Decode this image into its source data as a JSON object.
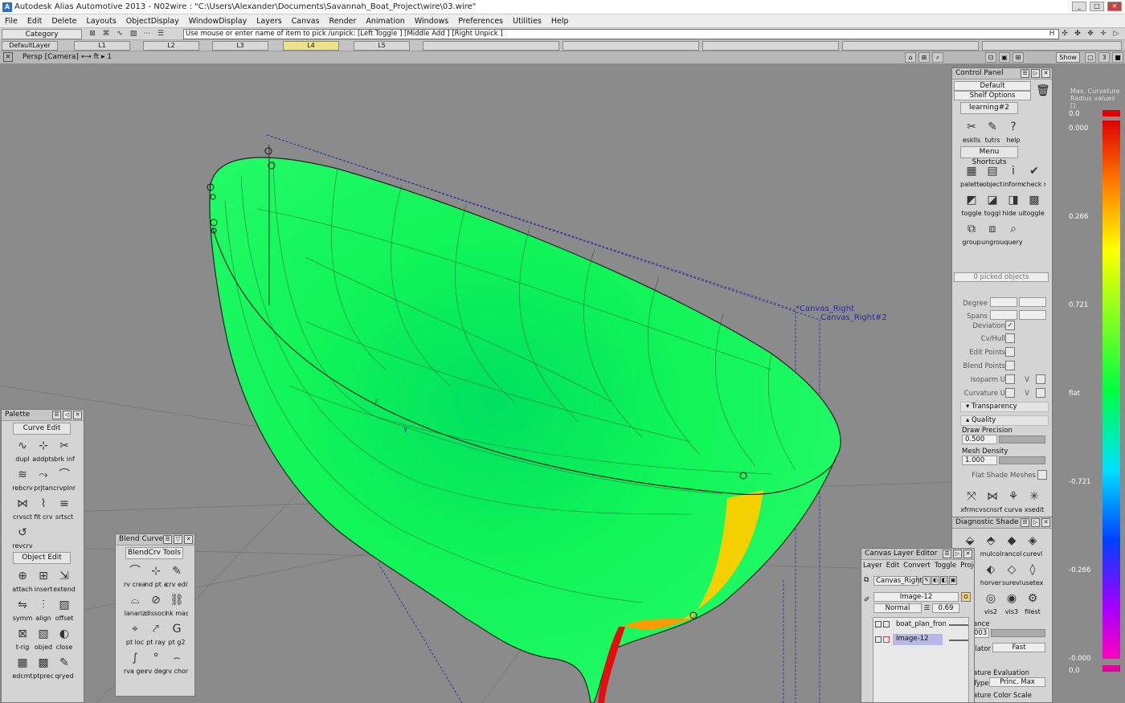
{
  "window": {
    "title": "Autodesk Alias Automotive 2013 - N02wire : \"C:\\Users\\Alexander\\Documents\\Savannah_Boat_Project\\wire\\03.wire\"",
    "app_icon_letter": "A"
  },
  "menu": [
    "File",
    "Edit",
    "Delete",
    "Layouts",
    "ObjectDisplay",
    "WindowDisplay",
    "Layers",
    "Canvas",
    "Render",
    "Animation",
    "Windows",
    "Preferences",
    "Utilities",
    "Help"
  ],
  "toolbar": {
    "category": "Category",
    "prompt": "Use mouse or enter name of item to pick /unpick: [Left Toggle ] [Middle Add ] [Right Unpick ]"
  },
  "layers": {
    "default": "DefaultLayer",
    "tabs": [
      "L1",
      "L2",
      "L3",
      "L4",
      "L5"
    ],
    "active": "L4"
  },
  "viewport": {
    "title": "Persp [Camera]",
    "units": "ft",
    "number": "1",
    "show_label": "Show",
    "labels": {
      "canvas_right": "*Canvas_Right",
      "canvas_right2": "Canvas_Right#2",
      "axis_z": "z",
      "axis_y": "y"
    }
  },
  "control_panel": {
    "title": "Control Panel",
    "default_select": "Default",
    "shelf_options": "Shelf Options",
    "learning_tab": "learning#2",
    "learning_tools": [
      "esklls",
      "tutrs",
      "help"
    ],
    "menu_shortcuts_tab": "Menu Shortcuts",
    "shortcut_tools": [
      "palette",
      "object",
      "inform",
      "check r",
      "toggle",
      "toggl",
      "hide ui",
      "toggle",
      "group",
      "ungrou",
      "query"
    ],
    "picked": "0 picked objects",
    "degree_label": "Degree",
    "spans_label": "Spans",
    "deviation_label": "Deviation",
    "cvhull_label": "Cv/Hull",
    "editpoints_label": "Edit Points",
    "blendpoints_label": "Blend Points",
    "isoparm_label": "Isoparm U",
    "curvature_label": "Curvature U",
    "v_label": "V",
    "transparency": "Transparency",
    "quality": "Quality",
    "draw_precision_label": "Draw Precision",
    "draw_precision": "0.500",
    "mesh_density_label": "Mesh Density",
    "mesh_density": "1.000",
    "flat_shade": "Flat Shade Meshes",
    "shelf_tools": [
      "xfrmcv",
      "scnsrf",
      "curva",
      "xsedit"
    ]
  },
  "diagnostic": {
    "title": "Diagnostic Shade",
    "tools": [
      "n",
      "mulcol",
      "rancol",
      "curevl",
      "ig",
      "horver",
      "surevl",
      "usetex",
      "",
      "vis2",
      "vis3",
      "filest"
    ],
    "tolerance_label": "ance",
    "tolerance_value": "003",
    "evaluator_label": "llator",
    "evaluator": "Fast",
    "curv_eval": "ature Evaluation",
    "type_label": "Type",
    "type": "Princ. Max",
    "color_scale": "ature Color Scale"
  },
  "legend": {
    "title": "Max. Curvature Radius values []",
    "ticks": [
      "0.0",
      "0.000",
      "0.266",
      "0.721",
      "flat",
      "-0.721",
      "-0.266",
      "-0.000",
      "0.0"
    ],
    "colors": {
      "top": "#e00000",
      "bottom": "#e000a0"
    }
  },
  "palette": {
    "title": "Palette",
    "curve_edit_tab": "Curve Edit",
    "curve_tools": [
      "dupl",
      "addpts",
      "brk inf",
      "rebcrv",
      "prjtan",
      "crvplnr",
      "crvsct",
      "fit crv",
      "srtsct",
      "revcrv"
    ],
    "object_edit_tab": "Object Edit",
    "object_tools": [
      "attach",
      "insert",
      "extend",
      "symm",
      "align",
      "offset",
      "t-rig",
      "objed",
      "close",
      "edcmt",
      "ptprec",
      "qryed"
    ]
  },
  "blend": {
    "title": "Blend Curve",
    "tab": "BlendCrv Tools",
    "tools": [
      "rv creat",
      "nd pt ad",
      "crv edit",
      "lanariz",
      "dissoci",
      "nk mas",
      "pt loc",
      "pt ray",
      "pt g2",
      "rva gec",
      "rv deg",
      "rv chor"
    ]
  },
  "canvas_layer": {
    "title": "Canvas Layer Editor",
    "menu": [
      "Layer",
      "Edit",
      "Convert",
      "Toggle",
      "Project"
    ],
    "canvas_select": "Canvas_Right",
    "image_name": "Image-12",
    "blend_mode": "Normal",
    "opacity": "0.69",
    "layers": [
      "boat_plan_front_",
      "Image-12"
    ]
  },
  "colors": {
    "surface": "#00f55a",
    "accent_yellow": "#f4d000",
    "accent_orange": "#ff9a00",
    "accent_red": "#e01010"
  }
}
